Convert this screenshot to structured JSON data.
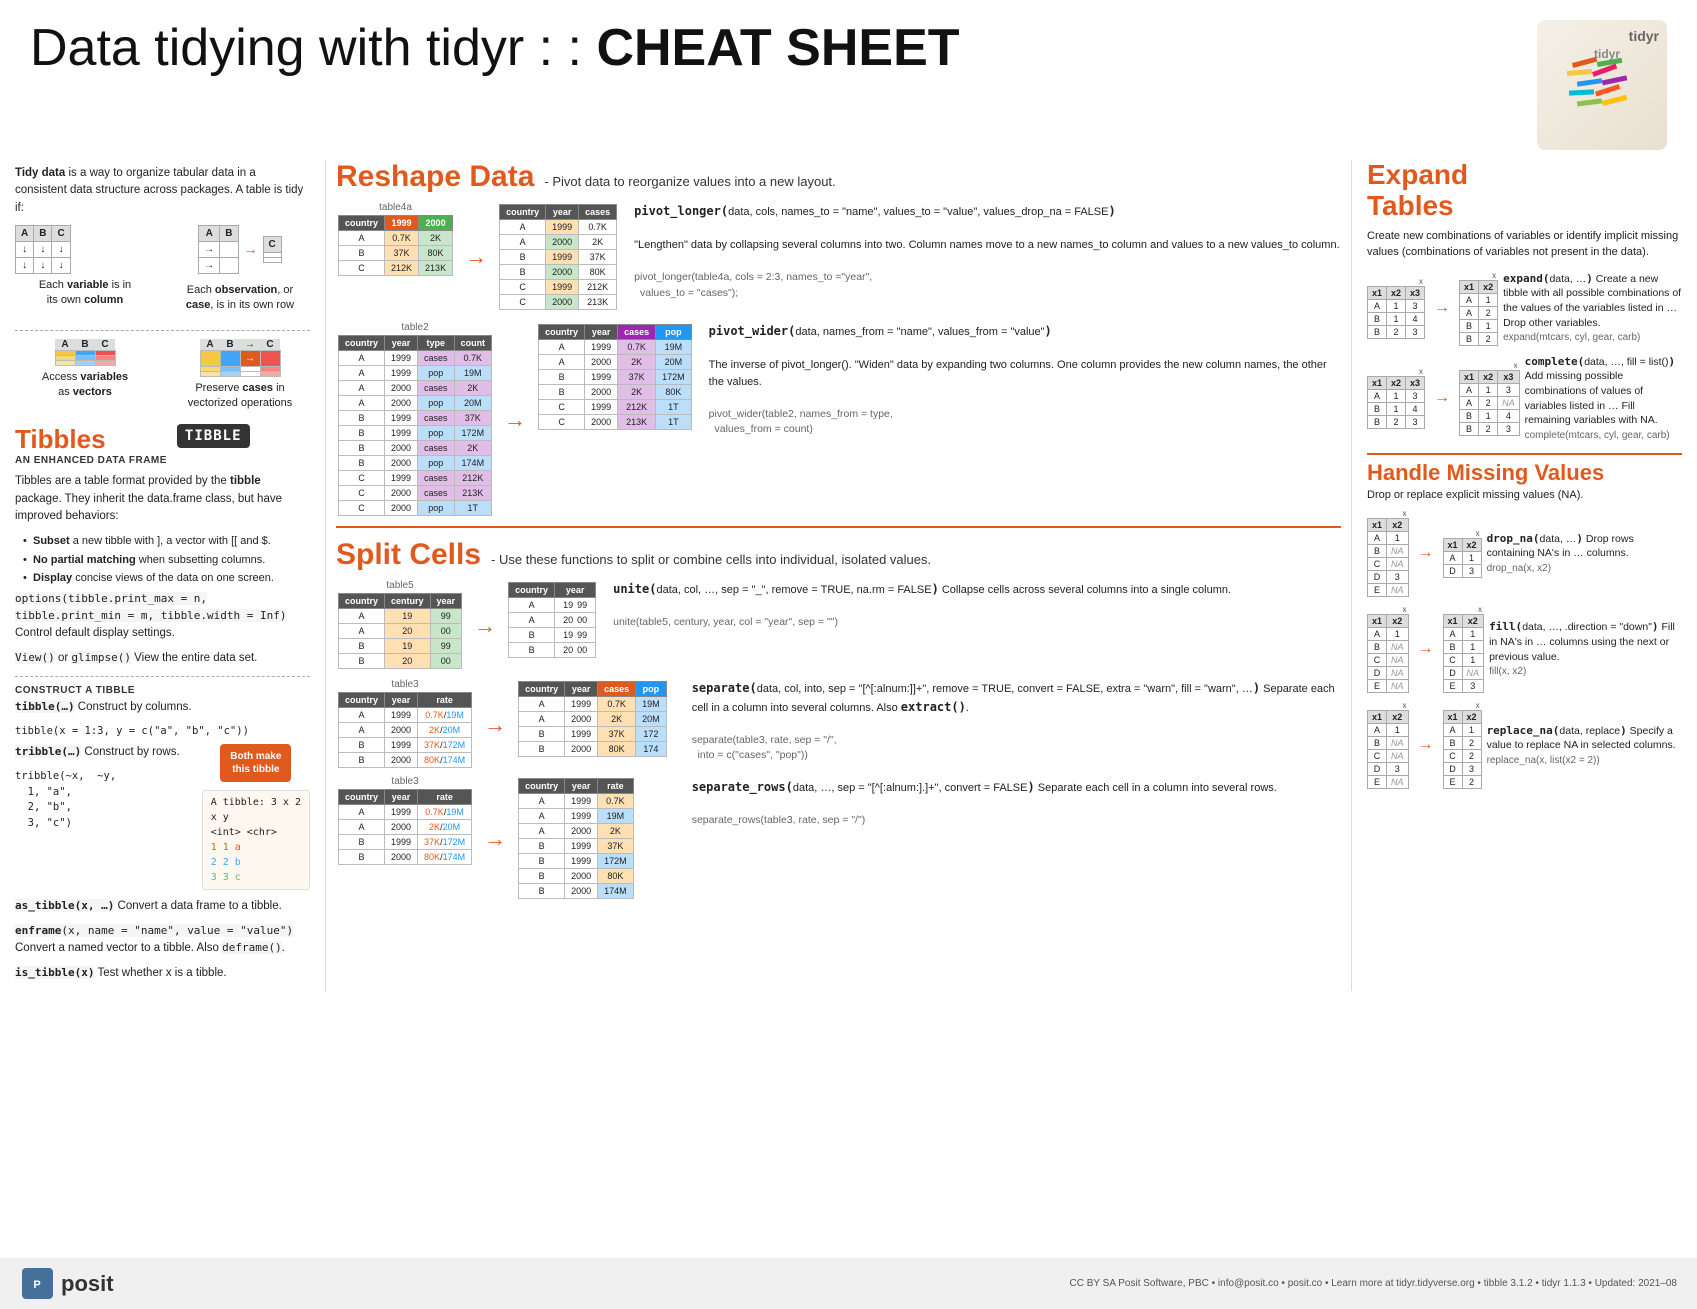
{
  "header": {
    "title_prefix": "Data tidying with tidyr : : ",
    "title_bold": "CHEAT SHEET"
  },
  "tidy_data": {
    "intro": "Tidy data is a way to organize tabular data in a consistent data structure across packages. A table is tidy if:",
    "rule1": "Each variable is in its own column",
    "rule2": "Each observation, or case, is in its own row",
    "rule3_part1": "Access variables as",
    "rule3_bold": "vectors",
    "rule4_part1": "Preserve",
    "rule4_bold": "cases",
    "rule4_part2": "in vectorized operations"
  },
  "tibbles": {
    "title": "Tibbles",
    "subtitle": "AN ENHANCED DATA FRAME",
    "logo_text": "TIBBLE",
    "desc": "Tibbles are a table format provided by the tibble package. They inherit the data.frame class, but have improved behaviors:",
    "bullets": [
      "Subset a new tibble with ], a vector with [[ and $.",
      "No partial matching when subsetting columns.",
      "Display concise views of the data on one screen."
    ],
    "options_code": "options(tibble.print_max = n, tibble.print_min = m, tibble.width = Inf) Control default display settings.",
    "view_code": "View() or glimpse() View the entire data set.",
    "construct_label": "CONSTRUCT A TIBBLE",
    "tibble_code": "tibble(…) Construct by columns.",
    "tibble_ex": "tibble(x = 1:3, y = c(\"a\", \"b\", \"c\"))",
    "both_make": "Both make\nthis tibble",
    "tribble_code": "tribble(…) Construct by rows.",
    "tribble_ex": "tribble(~x,  ~y,\n  1, \"a\",\n  2, \"b\",\n  3, \"c\")",
    "as_tibble": "as_tibble(x, …) Convert a data frame to a tibble.",
    "enframe": "enframe(x, name = \"name\", value = \"value\") Convert a named vector to a tibble. Also deframe().",
    "is_tibble": "is_tibble(x) Test whether x is a tibble."
  },
  "reshape": {
    "title": "Reshape Data",
    "subtitle": "- Pivot data to reorganize values into a new layout.",
    "table4a_label": "table4a",
    "table4a_headers": [
      "country",
      "1999",
      "2000"
    ],
    "table4a_rows": [
      [
        "A",
        "0.7K",
        "2K"
      ],
      [
        "B",
        "37K",
        "80K"
      ],
      [
        "C",
        "212K",
        "213K"
      ]
    ],
    "table4a_out_headers": [
      "country",
      "year",
      "cases"
    ],
    "table4a_out_rows": [
      [
        "A",
        "1999",
        "0.7K"
      ],
      [
        "A",
        "2000",
        "2K"
      ],
      [
        "B",
        "1999",
        "37K"
      ],
      [
        "B",
        "2000",
        "80K"
      ],
      [
        "C",
        "1999",
        "212K"
      ],
      [
        "C",
        "2000",
        "213K"
      ]
    ],
    "pivot_longer_func": "pivot_longer(data, cols, names_to = \"name\", values_to = \"value\", values_drop_na = FALSE)",
    "pivot_longer_desc": "\"Lengthen\" data by collapsing several columns into two. Column names move to a new names_to column and values to a new values_to column.",
    "pivot_longer_ex": "pivot_longer(table4a, cols = 2:3, names_to =\"year\", values_to = \"cases\");",
    "table2_label": "table2",
    "table2_headers": [
      "country",
      "year",
      "type",
      "count"
    ],
    "table2_rows": [
      [
        "A",
        "1999",
        "cases",
        "0.7K"
      ],
      [
        "A",
        "1999",
        "pop",
        "19M"
      ],
      [
        "A",
        "2000",
        "cases",
        "2K"
      ],
      [
        "A",
        "2000",
        "pop",
        "20M"
      ],
      [
        "B",
        "1999",
        "cases",
        "37K"
      ],
      [
        "B",
        "1999",
        "pop",
        "172M"
      ],
      [
        "B",
        "2000",
        "cases",
        "2K"
      ],
      [
        "B",
        "2000",
        "pop",
        "174M"
      ],
      [
        "C",
        "1999",
        "cases",
        "212K"
      ],
      [
        "C",
        "2000",
        "cases",
        "213K"
      ],
      [
        "C",
        "2000",
        "pop",
        "1T"
      ]
    ],
    "table2_out_headers": [
      "country",
      "year",
      "cases",
      "pop"
    ],
    "table2_out_rows": [
      [
        "A",
        "1999",
        "0.7K",
        "19M"
      ],
      [
        "A",
        "2000",
        "2K",
        "20M"
      ],
      [
        "B",
        "1999",
        "37K",
        "172M"
      ],
      [
        "B",
        "2000",
        "2K",
        "80K"
      ],
      [
        "C",
        "1999",
        "212K",
        "1T"
      ],
      [
        "C",
        "2000",
        "213K",
        "1T"
      ]
    ],
    "pivot_wider_func": "pivot_wider(data, names_from = \"name\", values_from = \"value\")",
    "pivot_wider_desc": "The inverse of pivot_longer(). \"Widen\" data by expanding two columns. One column provides the new column names, the other the values.",
    "pivot_wider_ex": "pivot_wider(table2, names_from = type, values_from = count)"
  },
  "split_cells": {
    "title": "Split Cells",
    "subtitle": "- Use these functions to split or combine cells into individual, isolated values.",
    "table5_label": "table5",
    "table5_headers": [
      "country",
      "century",
      "year"
    ],
    "table5_rows": [
      [
        "A",
        "19",
        "99"
      ],
      [
        "A",
        "20",
        "00"
      ],
      [
        "B",
        "19",
        "99"
      ],
      [
        "B",
        "20",
        "00"
      ]
    ],
    "table5_out_headers": [
      "country",
      "year"
    ],
    "table5_out_rows": [
      [
        "A",
        "19|99"
      ],
      [
        "A",
        "20|00"
      ],
      [
        "B",
        "19|99"
      ],
      [
        "B",
        "20|00"
      ]
    ],
    "unite_func": "unite(data, col, …, sep = \"_\", remove = TRUE, na.rm = FALSE) Collapse cells across several columns into a single column.",
    "unite_ex": "unite(table5, century, year, col = \"year\", sep = \"\")",
    "table3_label": "table3",
    "table3_headers": [
      "country",
      "year",
      "rate"
    ],
    "table3_rows": [
      [
        "A",
        "1999",
        "0.7K/19M"
      ],
      [
        "A",
        "2000",
        "2K/20M"
      ],
      [
        "B",
        "1999",
        "37K/172M"
      ],
      [
        "B",
        "2000",
        "80K/174M"
      ]
    ],
    "table3_sep_out_headers": [
      "country",
      "year",
      "cases",
      "pop"
    ],
    "table3_sep_out_rows": [
      [
        "A",
        "1999",
        "0.7K",
        "19M"
      ],
      [
        "A",
        "2000",
        "2K",
        "20M"
      ],
      [
        "B",
        "1999",
        "37K",
        "172"
      ],
      [
        "B",
        "2000",
        "80K",
        "174"
      ]
    ],
    "separate_func": "separate(data, col, into, sep = \"[^[:alnum:]]+\", remove = TRUE, convert = FALSE, extra = \"warn\", fill = \"warn\", …) Separate each cell in a column into several columns. Also extract().",
    "separate_ex": "separate(table3, rate, sep = \"/\", into = c(\"cases\", \"pop\"))",
    "table3b_rows": [
      [
        "A",
        "1999",
        "0.7K/19M"
      ],
      [
        "A",
        "2000",
        "2K/20M"
      ],
      [
        "B",
        "1999",
        "37K/172M"
      ],
      [
        "B",
        "2000",
        "80K/174M"
      ]
    ],
    "table3_rows_out_headers": [
      "country",
      "year",
      "rate"
    ],
    "table3_rows_out_rows": [
      [
        "A",
        "1999",
        "0.7K"
      ],
      [
        "A",
        "1999",
        "19M"
      ],
      [
        "A",
        "2000",
        "2K"
      ],
      [
        "B",
        "1999",
        "37K"
      ],
      [
        "B",
        "1999",
        "172M"
      ],
      [
        "B",
        "2000",
        "80K"
      ],
      [
        "B",
        "2000",
        "174M"
      ]
    ],
    "separate_rows_func": "separate_rows(data, …, sep = \"[^[:alnum:].]+\", convert = FALSE) Separate each cell in a column into several rows.",
    "separate_rows_ex": "separate_rows(table3, rate, sep = \"/\")"
  },
  "expand_tables": {
    "title_line1": "Expand",
    "title_line2": "Tables",
    "desc": "Create new combinations of variables or identify implicit missing values (combinations of variables not present in the data).",
    "expand_func": "expand(data, …) Create a new tibble with all possible combinations of the values of the variables listed in … Drop other variables.",
    "expand_ex": "expand(mtcars, cyl, gear, carb)",
    "complete_func": "complete(data, …, fill = list()) Add missing possible combinations of values of variables listed in … Fill remaining variables with NA.",
    "complete_ex": "complete(mtcars, cyl, gear, carb)",
    "table_x_before": {
      "header": "x",
      "cols": [
        "x1",
        "x2",
        "x3"
      ],
      "rows": [
        [
          "A",
          "1",
          "3"
        ],
        [
          "B",
          "1",
          "4"
        ],
        [
          "B",
          "2",
          "3"
        ]
      ]
    },
    "table_expand_after": {
      "header": "x",
      "cols": [
        "x1",
        "x2"
      ],
      "rows": [
        [
          "A",
          "1"
        ],
        [
          "A",
          "2"
        ],
        [
          "B",
          "1"
        ],
        [
          "B",
          "2"
        ]
      ]
    },
    "table_complete_before": {
      "header": "x",
      "cols": [
        "x1",
        "x2",
        "x3"
      ],
      "rows": [
        [
          "A",
          "1",
          "3"
        ],
        [
          "B",
          "1",
          "4"
        ],
        [
          "B",
          "2",
          "3"
        ]
      ]
    },
    "table_complete_after": {
      "header": "x",
      "cols": [
        "x1",
        "x2",
        "x3"
      ],
      "rows": [
        [
          "A",
          "1",
          "3"
        ],
        [
          "A",
          "2",
          "NA"
        ],
        [
          "B",
          "1",
          "4"
        ],
        [
          "B",
          "2",
          "3"
        ]
      ]
    }
  },
  "missing_values": {
    "title": "Handle Missing Values",
    "subtitle": "Drop or replace explicit missing values (NA).",
    "drop_na_func": "drop_na(data, …) Drop rows containing NA's in … columns.",
    "drop_na_ex": "drop_na(x, x2)",
    "fill_func": "fill(data, …, .direction = \"down\") Fill in NA's in … columns using the next or previous value.",
    "fill_ex": "fill(x, x2)",
    "replace_na_func": "replace_na(data, replace) Specify a value to replace NA in selected columns.",
    "replace_na_ex": "replace_na(x, list(x2 = 2))",
    "drop_na_before": {
      "cols": [
        "x1",
        "x2"
      ],
      "rows": [
        [
          "A",
          "1"
        ],
        [
          "B",
          "NA"
        ],
        [
          "C",
          "NA"
        ],
        [
          "D",
          "3"
        ],
        [
          "E",
          "NA"
        ]
      ]
    },
    "drop_na_after": {
      "cols": [
        "x1",
        "x2"
      ],
      "rows": [
        [
          "A",
          "1"
        ],
        [
          "D",
          "3"
        ]
      ]
    },
    "fill_before": {
      "cols": [
        "x1",
        "x2"
      ],
      "rows": [
        [
          "A",
          "1"
        ],
        [
          "B",
          "NA"
        ],
        [
          "C",
          "NA"
        ],
        [
          "D",
          "NA"
        ],
        [
          "E",
          "NA"
        ]
      ]
    },
    "fill_after": {
      "cols": [
        "x1",
        "x2"
      ],
      "rows": [
        [
          "A",
          "1"
        ],
        [
          "B",
          "1"
        ],
        [
          "C",
          "1"
        ],
        [
          "D",
          "NA"
        ],
        [
          "E",
          "3"
        ]
      ]
    },
    "replace_na_before": {
      "cols": [
        "x1",
        "x2"
      ],
      "rows": [
        [
          "A",
          "1"
        ],
        [
          "B",
          "NA"
        ],
        [
          "C",
          "NA"
        ],
        [
          "D",
          "3"
        ],
        [
          "E",
          "NA"
        ]
      ]
    },
    "replace_na_after": {
      "cols": [
        "x1",
        "x2"
      ],
      "rows": [
        [
          "A",
          "1"
        ],
        [
          "B",
          "2"
        ],
        [
          "C",
          "2"
        ],
        [
          "D",
          "3"
        ],
        [
          "E",
          "2"
        ]
      ]
    }
  },
  "footer": {
    "license": "CC BY SA Posit Software, PBC",
    "email": "info@posit.co",
    "website": "posit.co",
    "learn_more": "Learn more at tidyr.tidyverse.org",
    "package1": "tibble 3.1.2",
    "package2": "tidyr 1.1.3",
    "updated": "Updated: 2021–08",
    "posit_label": "posit"
  }
}
